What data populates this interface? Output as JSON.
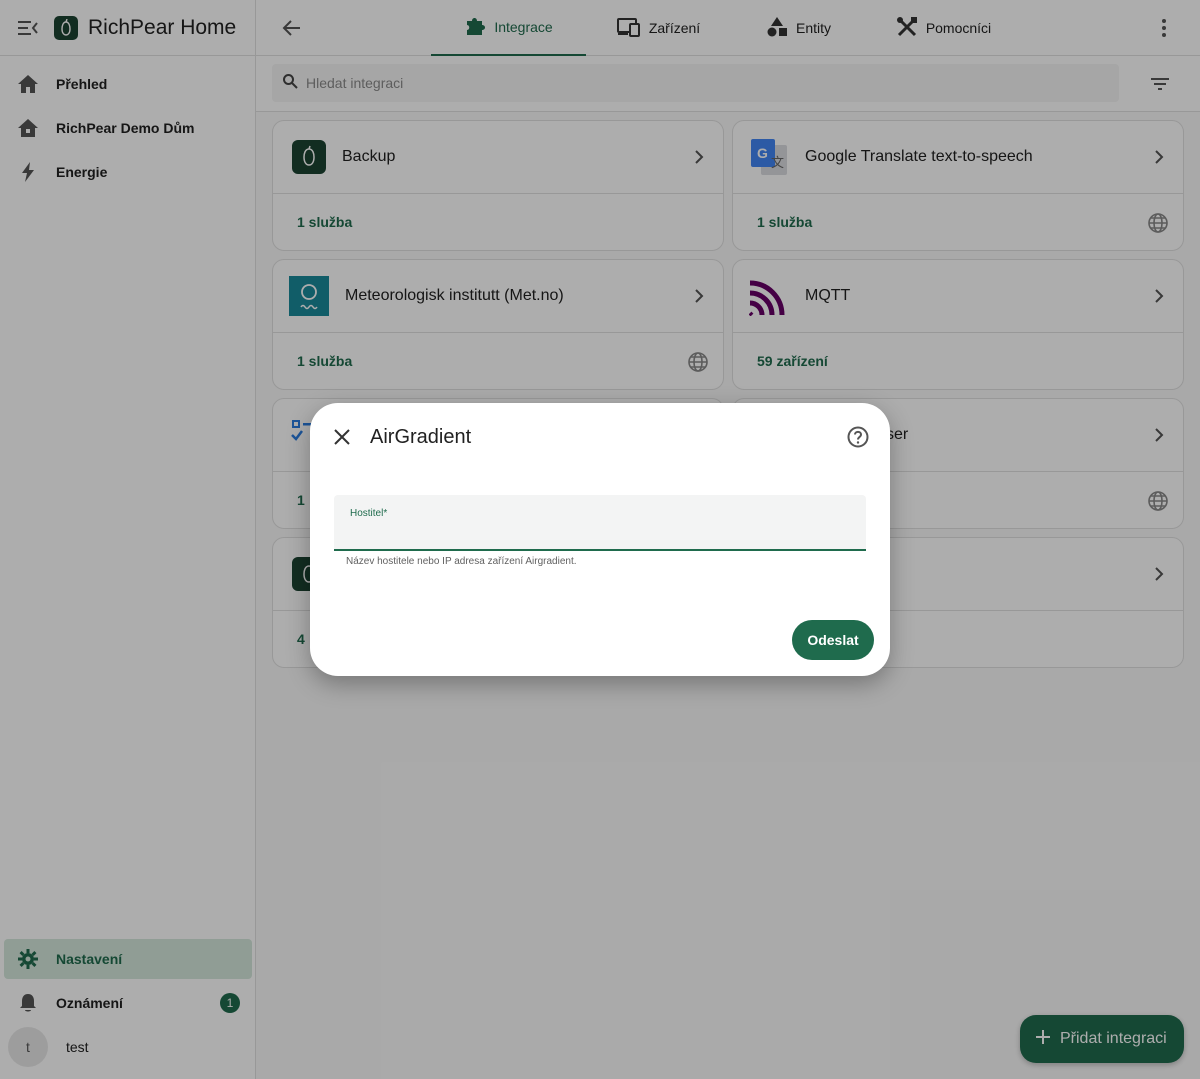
{
  "app": {
    "title": "RichPear Home"
  },
  "sidebar": {
    "items": [
      {
        "label": "Přehled",
        "icon": "home-icon"
      },
      {
        "label": "RichPear Demo Dům",
        "icon": "house-icon"
      },
      {
        "label": "Energie",
        "icon": "lightning-icon"
      }
    ],
    "bottom": {
      "settings_label": "Nastavení",
      "notifications_label": "Oznámení",
      "notifications_count": "1",
      "user_initial": "t",
      "user_name": "test"
    }
  },
  "tabs": [
    {
      "label": "Integrace",
      "icon": "puzzle-icon",
      "active": true
    },
    {
      "label": "Zařízení",
      "icon": "devices-icon"
    },
    {
      "label": "Entity",
      "icon": "shapes-icon"
    },
    {
      "label": "Pomocníci",
      "icon": "tools-icon"
    }
  ],
  "search": {
    "placeholder": "Hledat integraci"
  },
  "cards": [
    {
      "name": "Backup",
      "meta": "1 služba",
      "globe": false
    },
    {
      "name": "Google Translate text-to-speech",
      "meta": "1 služba",
      "globe": true
    },
    {
      "name": "Meteorologisk institutt (Met.no)",
      "meta": "1 služba",
      "globe": true
    },
    {
      "name": "MQTT",
      "meta": "59 zařízení",
      "globe": false
    },
    {
      "name_partial": "ser",
      "meta_partial": "1",
      "globe": true
    },
    {
      "meta_partial": "4"
    }
  ],
  "fab": {
    "label": "Přidat integraci"
  },
  "dialog": {
    "title": "AirGradient",
    "field_label": "Hostitel*",
    "field_value": "",
    "field_helper": "Název hostitele nebo IP adresa zařízení Airgradient.",
    "submit_label": "Odeslat"
  },
  "colors": {
    "primary": "#1f6b4d",
    "active_bg": "#d4e8dc",
    "mqtt": "#660066",
    "metno": "#1a8a9a"
  }
}
